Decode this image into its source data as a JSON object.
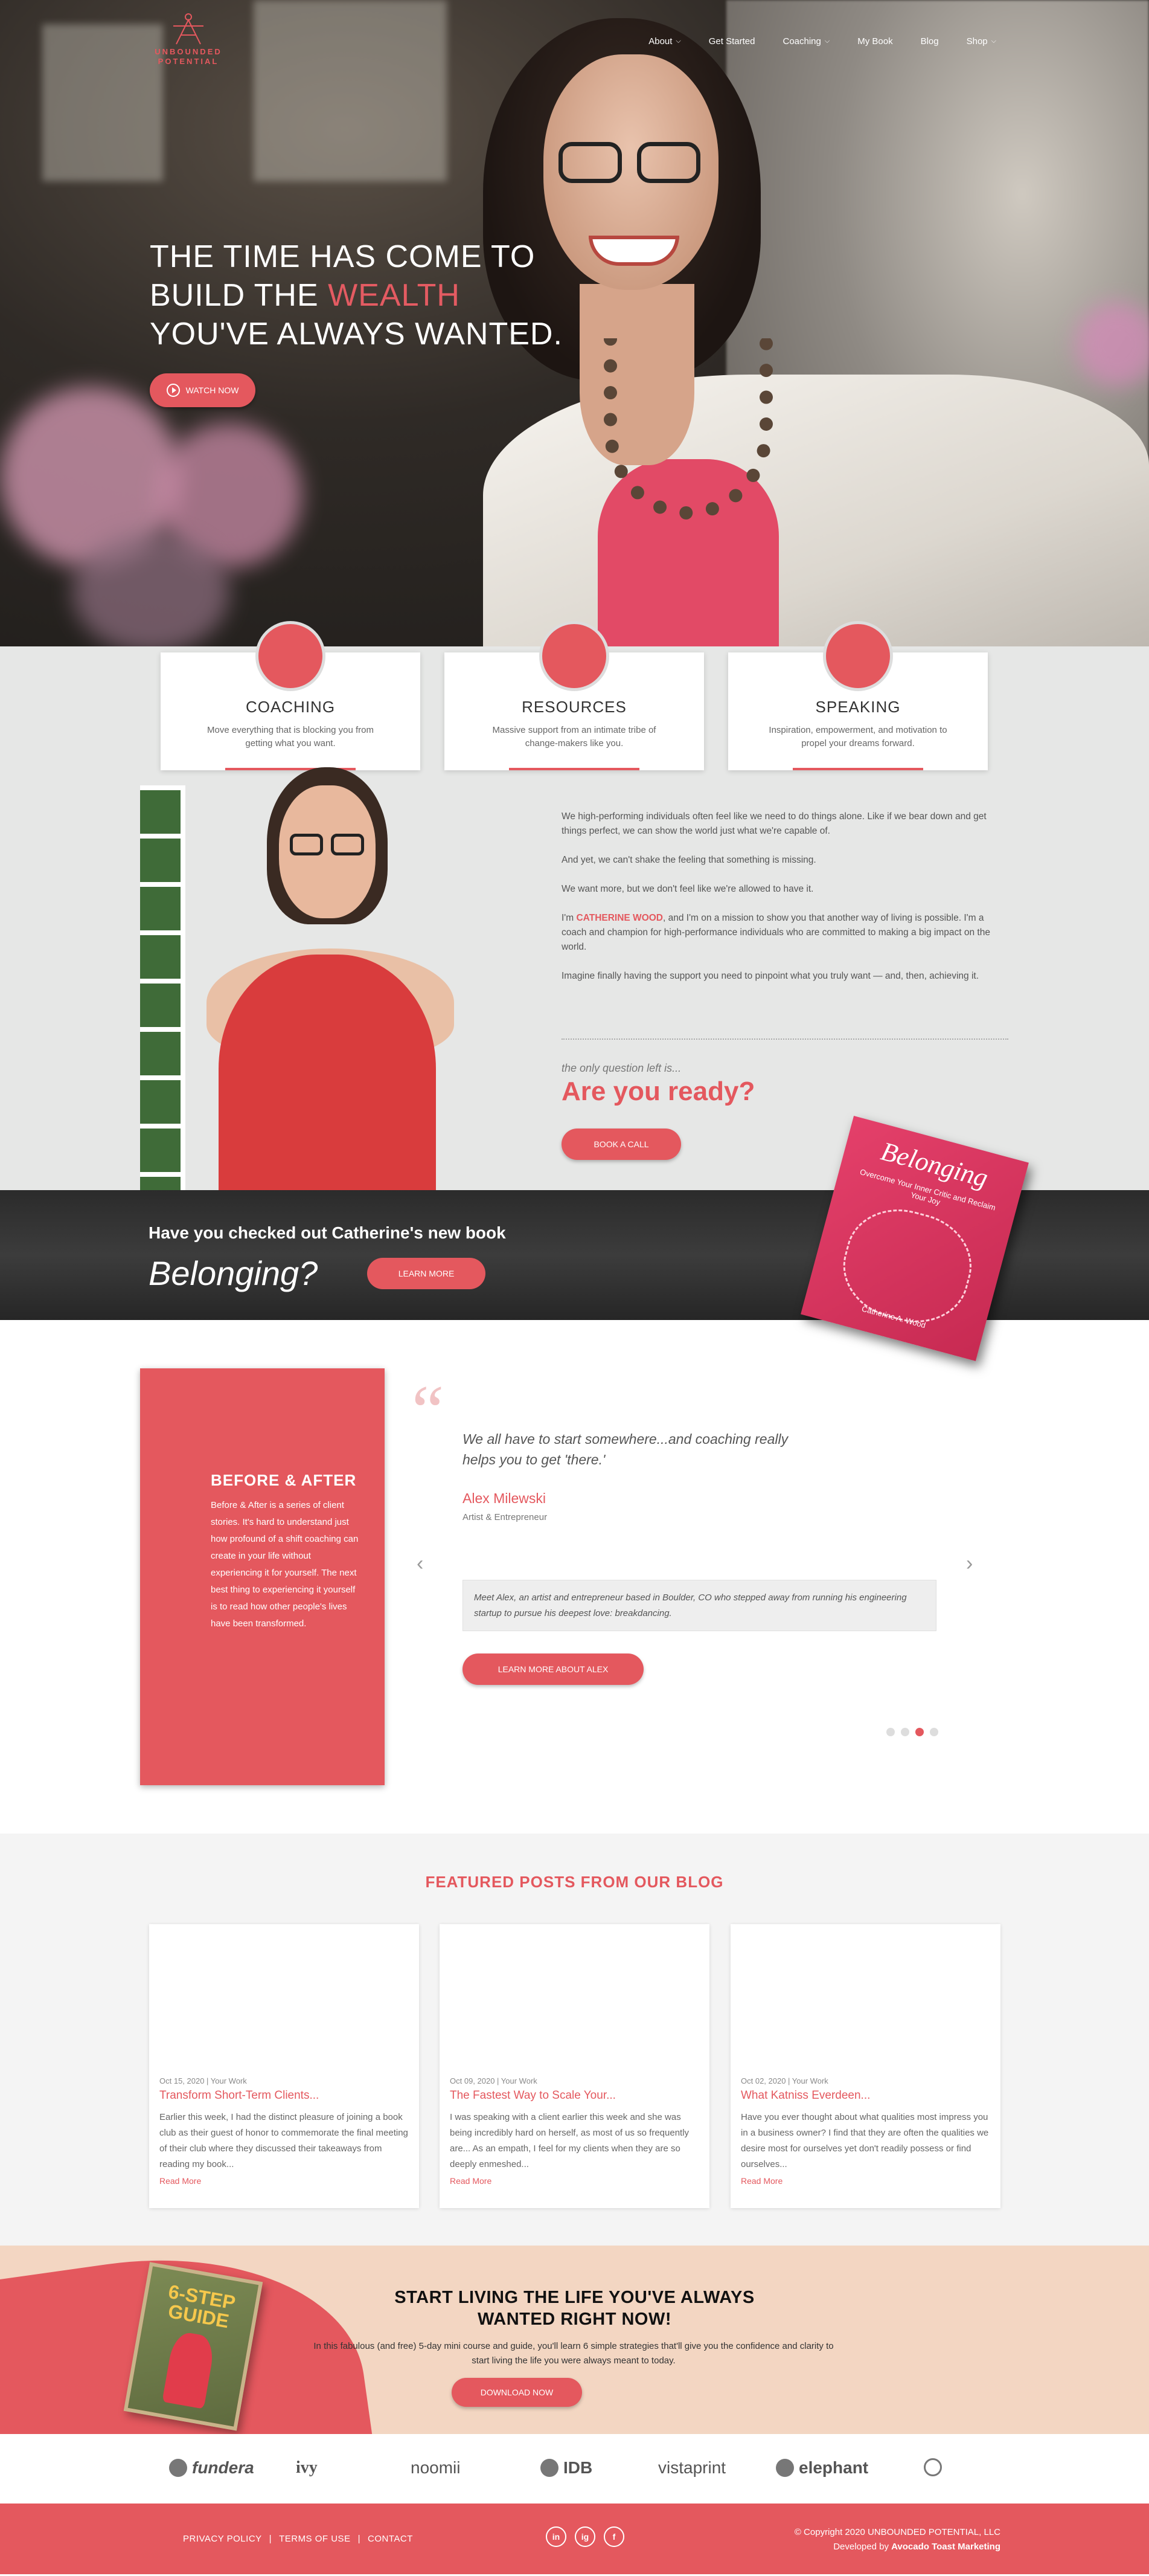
{
  "colors": {
    "accent": "#e4585e",
    "dark_band": "#2b2b2b",
    "gray_band": "#e6e7e6",
    "cta_bg": "#f3d6c2"
  },
  "brand": {
    "line1": "UNBOUNDED",
    "line2": "POTENTIAL"
  },
  "nav": {
    "items": [
      {
        "label": "About",
        "dropdown": true
      },
      {
        "label": "Get Started",
        "dropdown": false
      },
      {
        "label": "Coaching",
        "dropdown": true
      },
      {
        "label": "My Book",
        "dropdown": false
      },
      {
        "label": "Blog",
        "dropdown": false
      },
      {
        "label": "Shop",
        "dropdown": true
      }
    ]
  },
  "hero": {
    "line1": "THE TIME HAS COME TO",
    "line2_pre": "BUILD THE ",
    "line2_accent": "WEALTH",
    "line3": "YOU'VE ALWAYS WANTED.",
    "watch_label": "WATCH NOW"
  },
  "cards": [
    {
      "title": "COACHING",
      "desc": "Move everything that is blocking you from getting what you want."
    },
    {
      "title": "RESOURCES",
      "desc": "Massive support from an intimate tribe of change-makers like you."
    },
    {
      "title": "SPEAKING",
      "desc": "Inspiration, empowerment, and motivation to propel your dreams forward."
    }
  ],
  "about": {
    "p1": "We high-performing individuals often feel like we need to do things alone. Like if we bear down and get things perfect, we can show the world just what we're capable of.",
    "p2": "And yet, we can't shake the feeling that something is missing.",
    "p3": "We want more, but we don't feel like we're allowed to have it.",
    "p4_pre": "I'm ",
    "p4_name": "CATHERINE WOOD",
    "p4_post": ", and I'm on a mission to show you that another way of living is possible. I'm a coach and champion for high-performance individuals who are committed to making a big impact on the world.",
    "p5": "Imagine finally having the support you need to pinpoint what you truly want — and, then, achieving it.",
    "only_question": "the only question left is...",
    "ready": "Are you ready?",
    "book_call": "BOOK A CALL"
  },
  "book": {
    "question": "Have you checked out Catherine's new book",
    "title": "Belonging?",
    "learn_more": "LEARN MORE",
    "cover_title": "Belonging",
    "cover_subtitle": "Overcome Your Inner Critic and Reclaim Your Joy",
    "cover_author": "Catherine A. Wood"
  },
  "testimonial": {
    "box_title": "BEFORE & AFTER",
    "box_text": "Before & After is a series of client stories. It's hard to understand just how profound of a shift coaching can create in your life without experiencing it for yourself. The next best thing to experiencing it yourself is to read how other people's lives have been transformed.",
    "quote": "We all have to start somewhere...and coaching really helps you to get 'there.'",
    "name": "Alex Milewski",
    "role": "Artist & Entrepreneur",
    "summary": "Meet Alex, an artist and entrepreneur based in Boulder, CO who stepped away from running his engineering startup to pursue his deepest love: breakdancing.",
    "button": "LEARN MORE ABOUT ALEX",
    "dots_total": 4,
    "dots_active": 3
  },
  "blog": {
    "heading": "FEATURED POSTS FROM OUR BLOG",
    "posts": [
      {
        "meta": "Oct 15, 2020 | Your Work",
        "title": "Transform Short-Term Clients...",
        "excerpt": "Earlier this week, I had the distinct pleasure of joining a book club as their guest of honor to commemorate the final meeting of their club where they discussed their takeaways from reading my book...",
        "more": "Read More"
      },
      {
        "meta": "Oct 09, 2020 | Your Work",
        "title": "The Fastest Way to Scale Your...",
        "excerpt": "I was speaking with a client earlier this week and she was being incredibly hard on herself, as most of us so frequently are... As an empath, I feel for my clients when they are so deeply enmeshed...",
        "more": "Read More"
      },
      {
        "meta": "Oct 02, 2020 | Your Work",
        "title": "What Katniss Everdeen...",
        "excerpt": "Have you ever thought about what qualities most impress you in a business owner? I find that they are often the qualities we desire most for ourselves yet don't readily possess or find ourselves...",
        "more": "Read More"
      }
    ]
  },
  "cta": {
    "guide_title": "6-STEP GUIDE",
    "line1": "START LIVING THE LIFE YOU'VE ALWAYS",
    "line2": "WANTED RIGHT NOW!",
    "text": "In this fabulous (and free) 5-day mini course and guide, you'll learn 6 simple strategies that'll give you the confidence and clarity to start living the life you were always meant to today.",
    "button": "DOWNLOAD NOW"
  },
  "partners": [
    "fundera",
    "ivy",
    "noomii",
    "IDB",
    "vistaprint",
    "elephant"
  ],
  "footer": {
    "links": [
      "PRIVACY POLICY",
      "TERMS OF USE",
      "CONTACT"
    ],
    "social": [
      "in",
      "ig",
      "f"
    ],
    "copyright": "© Copyright 2020 UNBOUNDED POTENTIAL, LLC",
    "dev_pre": "Developed by ",
    "dev_name": "Avocado Toast Marketing"
  }
}
